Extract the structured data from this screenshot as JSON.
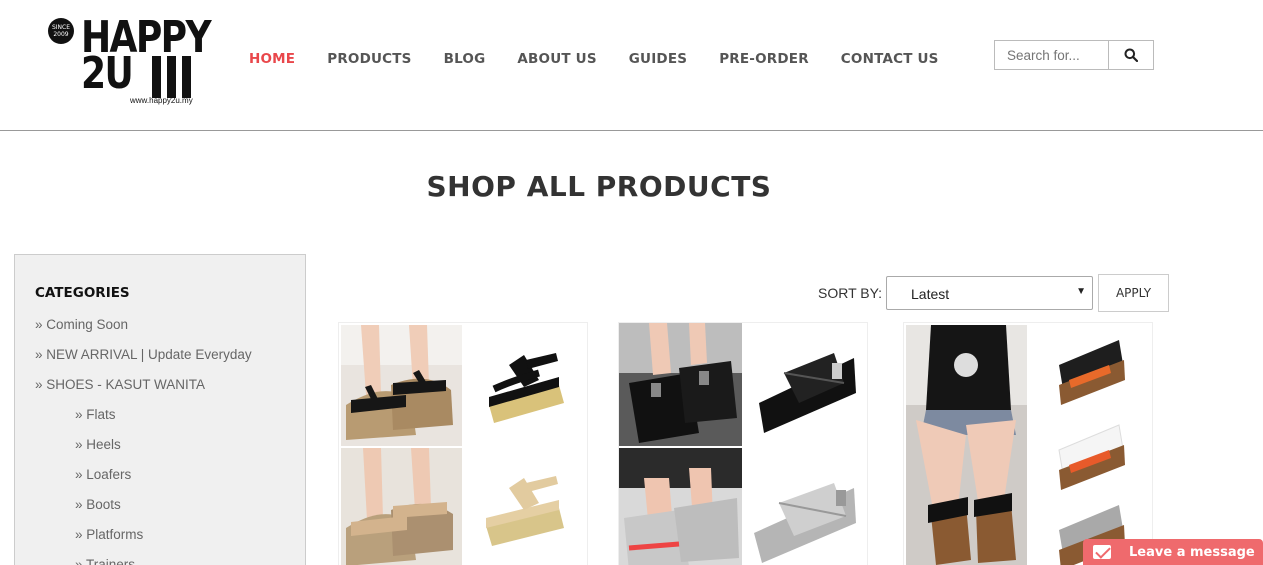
{
  "logo": {
    "since": "SINCE 2009",
    "line1": "HAPPY",
    "line2": "2U",
    "url": "www.happy2u.my"
  },
  "nav": [
    {
      "label": "HOME",
      "active": true
    },
    {
      "label": "PRODUCTS",
      "active": false
    },
    {
      "label": "BLOG",
      "active": false
    },
    {
      "label": "ABOUT US",
      "active": false
    },
    {
      "label": "GUIDES",
      "active": false
    },
    {
      "label": "PRE-ORDER",
      "active": false
    },
    {
      "label": "CONTACT US",
      "active": false
    }
  ],
  "search": {
    "placeholder": "Search for...",
    "icon": "search-icon"
  },
  "page_title": "SHOP ALL PRODUCTS",
  "sidebar": {
    "heading": "CATEGORIES",
    "items": [
      {
        "label": "» Coming Soon",
        "sub": false
      },
      {
        "label": "» NEW ARRIVAL | Update Everyday",
        "sub": false
      },
      {
        "label": "» SHOES - KASUT WANITA",
        "sub": false
      },
      {
        "label": "» Flats",
        "sub": true
      },
      {
        "label": "» Heels",
        "sub": true
      },
      {
        "label": "» Loafers",
        "sub": true
      },
      {
        "label": "» Boots",
        "sub": true
      },
      {
        "label": "» Platforms",
        "sub": true
      },
      {
        "label": "» Trainers",
        "sub": true
      }
    ]
  },
  "sort": {
    "label": "SORT BY:",
    "selected": "Latest",
    "apply_label": "APPLY"
  },
  "chat": {
    "label": "Leave a message",
    "icon": "mail-icon"
  },
  "colors": {
    "accent": "#e9474b",
    "chat": "#ef6a6d"
  }
}
